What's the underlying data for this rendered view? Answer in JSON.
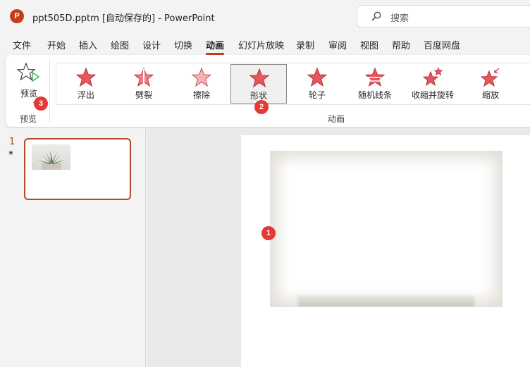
{
  "window": {
    "app_logo": "P",
    "title": "ppt505D.pptm [自动保存的]  -  PowerPoint"
  },
  "search": {
    "placeholder": "搜索",
    "icon": "search-icon"
  },
  "tabs": [
    {
      "label": "文件"
    },
    {
      "label": "开始"
    },
    {
      "label": "插入"
    },
    {
      "label": "绘图"
    },
    {
      "label": "设计"
    },
    {
      "label": "切换"
    },
    {
      "label": "动画",
      "active": true
    },
    {
      "label": "幻灯片放映"
    },
    {
      "label": "录制"
    },
    {
      "label": "审阅"
    },
    {
      "label": "视图"
    },
    {
      "label": "帮助"
    },
    {
      "label": "百度网盘"
    }
  ],
  "ribbon": {
    "preview_label": "预览",
    "preview_group_label": "预览",
    "animation_group_label": "动画",
    "animations": [
      {
        "label": "浮出"
      },
      {
        "label": "劈裂"
      },
      {
        "label": "擦除"
      },
      {
        "label": "形状",
        "selected": true
      },
      {
        "label": "轮子"
      },
      {
        "label": "随机线条"
      },
      {
        "label": "收缩并旋转"
      },
      {
        "label": "缩放"
      }
    ]
  },
  "badges": {
    "photo": "1",
    "shape": "2",
    "preview": "3"
  },
  "slides": [
    {
      "number": "1",
      "star": "★"
    }
  ],
  "colors": {
    "accent": "#c43e1c",
    "badge": "#e53935",
    "star": "#e8565d"
  }
}
